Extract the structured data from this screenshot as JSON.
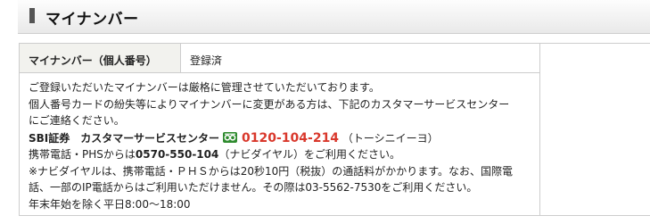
{
  "section": {
    "title": "マイナンバー"
  },
  "row": {
    "label": "マイナンバー（個人番号）",
    "value": "登録済"
  },
  "notice": {
    "line1": "ご登録いただいたマイナンバーは厳格に管理させていただいております。",
    "line2": "個人番号カードの紛失等によりマイナンバーに変更がある方は、下記のカスタマーサービスセンター",
    "line3": "にご連絡ください。",
    "center_name": "SBI証券　カスタマーサービスセンター",
    "freedial_icon": "freedial-icon",
    "freedial_number": "0120-104-214",
    "freedial_reading": "（トーシニイーヨ）",
    "mobile_prefix": "携帯電話・PHSからは",
    "navi_number": "0570-550-104",
    "mobile_suffix": "（ナビダイヤル）をご利用ください。",
    "note1": "※ナビダイヤルは、携帯電話・ＰＨＳからは20秒10円（税抜）の通話料がかかります。なお、国際電",
    "note2": "話、一部のIP電話からはご利用いただけません。その際は03-5562-7530をご利用ください。",
    "hours": "年末年始を除く平日8:00〜18:00"
  },
  "colors": {
    "accent_red": "#d9382c",
    "freedial_green": "#2e8b2e",
    "label_bg": "#f2f2ee"
  }
}
